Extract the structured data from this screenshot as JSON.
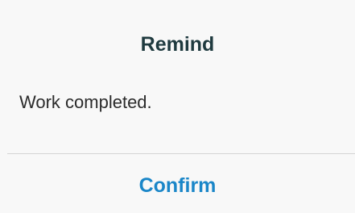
{
  "dialog": {
    "title": "Remind",
    "message": "Work completed.",
    "confirm_label": "Confirm"
  },
  "colors": {
    "title": "#1f3a3f",
    "message": "#2b2b2b",
    "accent": "#1a86c8",
    "background": "#f8f8f8",
    "divider": "#d4d4d4"
  }
}
